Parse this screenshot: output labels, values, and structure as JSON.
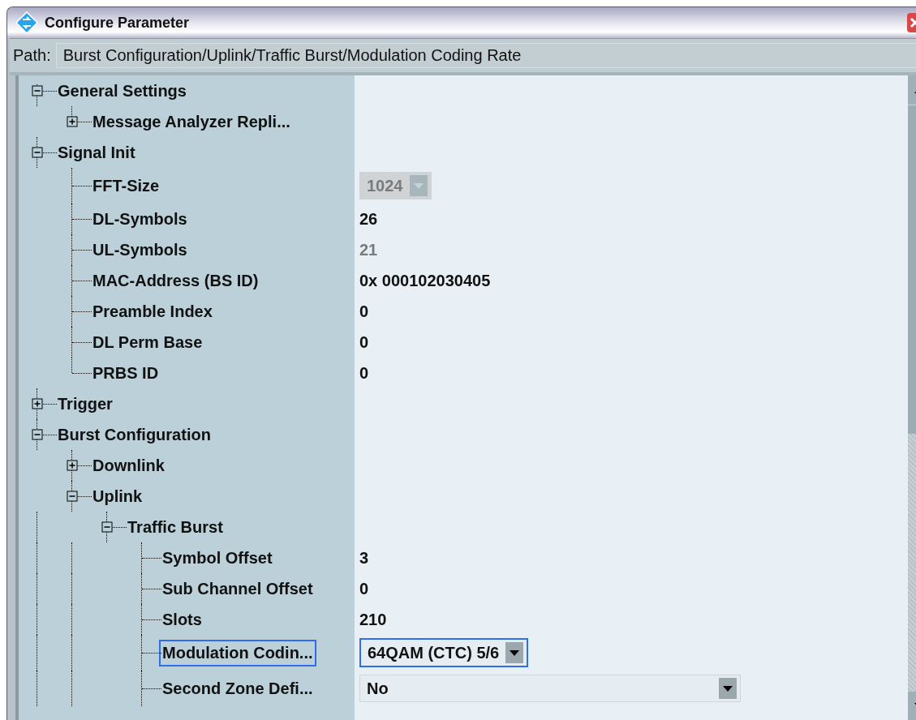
{
  "window": {
    "title": "Configure Parameter"
  },
  "path": {
    "label": "Path:",
    "value": "Burst Configuration/Uplink/Traffic Burst/Modulation Coding Rate"
  },
  "tree": [
    {
      "label": "General Settings",
      "expanded": true,
      "selected": false,
      "children": [
        {
          "label": "Message Analyzer Repli...",
          "expanded": false,
          "selected": false
        }
      ]
    },
    {
      "label": "Signal Init",
      "expanded": true,
      "selected": false,
      "children": [
        {
          "label": "FFT-Size",
          "selected": false,
          "value": {
            "kind": "combo",
            "text": "1024",
            "disabled": true
          }
        },
        {
          "label": "DL-Symbols",
          "selected": false,
          "value": {
            "kind": "text",
            "text": "26",
            "disabled": false
          }
        },
        {
          "label": "UL-Symbols",
          "selected": false,
          "value": {
            "kind": "text",
            "text": "21",
            "disabled": true
          }
        },
        {
          "label": "MAC-Address (BS ID)",
          "selected": false,
          "value": {
            "kind": "text",
            "text": "0x 000102030405",
            "disabled": false
          }
        },
        {
          "label": "Preamble Index",
          "selected": false,
          "value": {
            "kind": "text",
            "text": "0",
            "disabled": false
          }
        },
        {
          "label": "DL Perm Base",
          "selected": false,
          "value": {
            "kind": "text",
            "text": "0",
            "disabled": false
          }
        },
        {
          "label": "PRBS ID",
          "selected": false,
          "value": {
            "kind": "text",
            "text": "0",
            "disabled": false
          }
        }
      ]
    },
    {
      "label": "Trigger",
      "expanded": false,
      "selected": false
    },
    {
      "label": "Burst Configuration",
      "expanded": true,
      "selected": false,
      "children": [
        {
          "label": "Downlink",
          "expanded": false,
          "selected": false
        },
        {
          "label": "Uplink",
          "expanded": true,
          "selected": false,
          "children": [
            {
              "label": "Traffic Burst",
              "expanded": true,
              "selected": false,
              "children": [
                {
                  "label": "Symbol Offset",
                  "selected": false,
                  "value": {
                    "kind": "text",
                    "text": "3",
                    "disabled": false
                  }
                },
                {
                  "label": "Sub Channel Offset",
                  "selected": false,
                  "value": {
                    "kind": "text",
                    "text": "0",
                    "disabled": false
                  }
                },
                {
                  "label": "Slots",
                  "selected": false,
                  "value": {
                    "kind": "text",
                    "text": "210",
                    "disabled": false
                  }
                },
                {
                  "label": "Modulation Codin...",
                  "selected": true,
                  "value": {
                    "kind": "combo",
                    "text": "64QAM (CTC) 5/6",
                    "disabled": false
                  }
                },
                {
                  "label": "Second Zone Defi...",
                  "selected": false,
                  "value": {
                    "kind": "combo-wide",
                    "text": "No",
                    "disabled": false
                  }
                }
              ]
            }
          ]
        }
      ]
    }
  ]
}
